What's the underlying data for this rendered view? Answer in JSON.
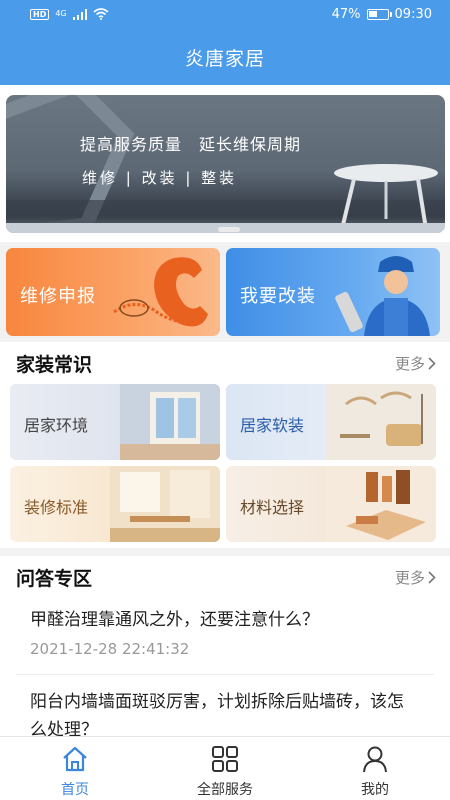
{
  "status": {
    "hd": "HD",
    "network": "4G",
    "battery": "47%",
    "battery_level": 0.47,
    "time": "09:30"
  },
  "app": {
    "title": "炎唐家居"
  },
  "banner": {
    "headline": "提高服务质量　延长维保周期",
    "sub": "维修 | 改装 | 整装"
  },
  "services": [
    {
      "label": "维修申报",
      "color": "#f8863e"
    },
    {
      "label": "我要改装",
      "color": "#3f8ee6"
    }
  ],
  "knowledge": {
    "title": "家装常识",
    "more": "更多",
    "items": [
      {
        "label": "居家环境"
      },
      {
        "label": "居家软装"
      },
      {
        "label": "装修标准"
      },
      {
        "label": "材料选择"
      }
    ]
  },
  "qa": {
    "title": "问答专区",
    "more": "更多",
    "items": [
      {
        "question": "甲醛治理靠通风之外，还要注意什么？",
        "time": "2021-12-28 22:41:32"
      },
      {
        "question": "阳台内墙墙面斑驳厉害，计划拆除后贴墙砖，该怎么处理？"
      }
    ]
  },
  "tabs": [
    {
      "label": "首页",
      "icon": "home-icon",
      "active": true
    },
    {
      "label": "全部服务",
      "icon": "grid-icon",
      "active": false
    },
    {
      "label": "我的",
      "icon": "user-icon",
      "active": false
    }
  ],
  "colors": {
    "primary": "#4a9bea",
    "tab_active": "#3b86de",
    "repair": "#f8863e",
    "reform": "#3f8ee6"
  }
}
